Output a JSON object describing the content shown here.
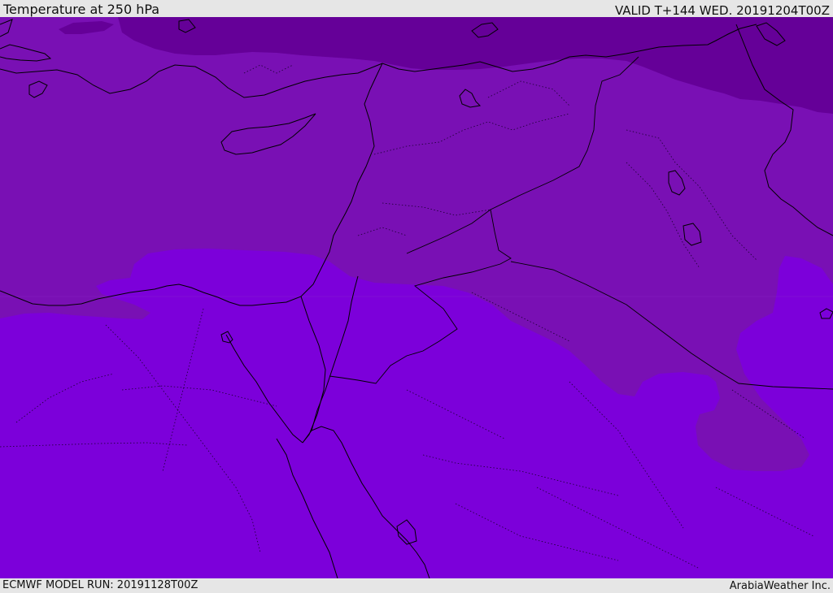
{
  "header": {
    "title": "Temperature at 250 hPa",
    "valid_time": "VALID T+144 WED. 20191204T00Z"
  },
  "footer": {
    "model_run": "ECMWF MODEL RUN: 20191128T00Z",
    "credit": "ArabiaWeather Inc."
  },
  "map": {
    "field": "temperature",
    "level": "250 hPa",
    "colors": {
      "band_cold": "#650098",
      "band_mid": "#7910b4",
      "band_warm": "#7c00da",
      "coastline": "#000000",
      "borders": "#1a0030"
    }
  }
}
